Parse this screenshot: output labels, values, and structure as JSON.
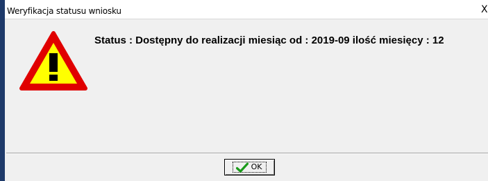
{
  "window": {
    "title": "Weryfikacja statusu wniosku",
    "close_label": "X"
  },
  "dialog": {
    "icon": "warning-icon",
    "message": "Status : Dostępny do realizacji miesiąc od : 2019-09 ilość miesięcy : 12"
  },
  "buttons": {
    "ok_label": "OK",
    "ok_icon": "checkmark-icon"
  },
  "colors": {
    "warning_fill": "#ffff00",
    "warning_border": "#e00000",
    "check": "#1a9a1a"
  }
}
